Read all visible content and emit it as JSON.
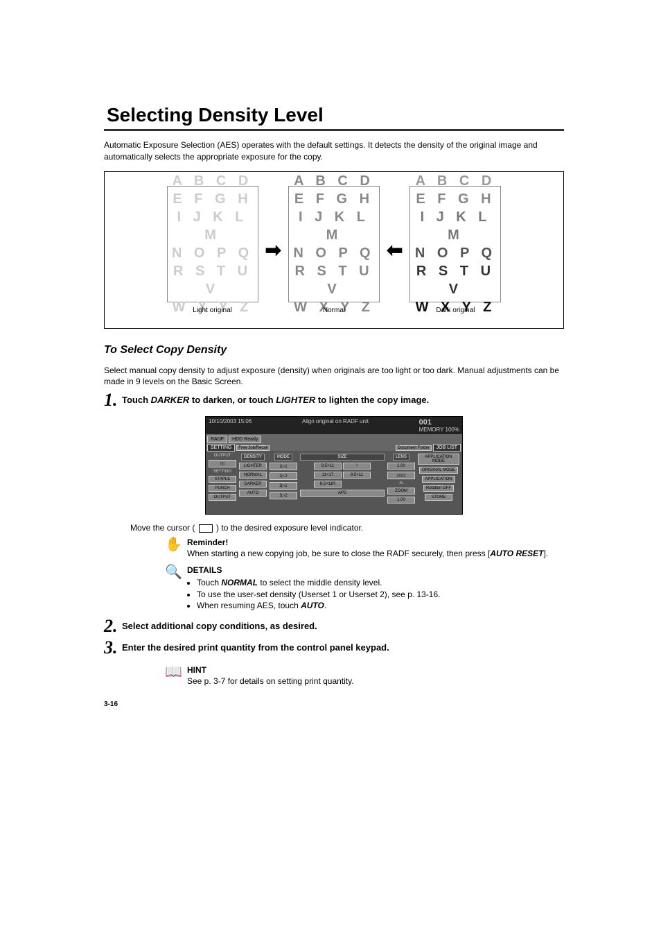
{
  "title": "Selecting Density Level",
  "intro": "Automatic Exposure Selection (AES) operates with the default settings. It detects the density of the original image and automatically selects the appropriate exposure for the copy.",
  "diagram": {
    "letters": [
      "A B C D",
      "E F G H",
      "I J K L M",
      "N O P Q",
      "R S T U V",
      "W X Y Z"
    ],
    "captions": {
      "light": "Light original",
      "normal": "Normal",
      "dark": "Dark original"
    }
  },
  "subheading": "To Select Copy Density",
  "subbody": "Select manual copy density to adjust exposure (density) when originals are too light or too dark. Manual adjustments can be made in 9 levels on the Basic Screen.",
  "steps": {
    "s1": {
      "num": "1.",
      "pre": "Touch ",
      "darker": "DARKER",
      "mid": " to darken, or touch ",
      "lighter": "LIGHTER",
      "post": " to lighten the copy image."
    },
    "s2": {
      "num": "2.",
      "text": "Select additional copy conditions, as desired."
    },
    "s3": {
      "num": "3.",
      "text": "Enter the desired print quantity from the control panel keypad."
    }
  },
  "screenshot": {
    "topbar": {
      "datetime": "10/10/2003 15:06",
      "msg": "Align original on RADF unit",
      "count": "001",
      "memory": "MEMORY 100%"
    },
    "tabs": {
      "radf": "RADF",
      "hdd": "HDD Ready"
    },
    "row2": {
      "setting": "SETTING",
      "recall": "Free Job/Recall",
      "docfolder": "Document Folder",
      "joblist": "JOB LIST"
    },
    "leftOutput": {
      "label": "OUTPUT",
      "sample": "▯▯"
    },
    "leftSetting": {
      "label": "SETTING",
      "staple": "STAPLE",
      "punch": "PUNCH",
      "output": "OUTPUT"
    },
    "density": {
      "header": "DENSITY",
      "lighter": "LIGHTER",
      "normal": "NORMAL",
      "darker": "DARKER",
      "auto": "AUTO"
    },
    "mode": {
      "header": "MODE",
      "m1": "1▷1",
      "m2": "1▷2",
      "m3": "2▷1",
      "m4": "2▷2"
    },
    "size": {
      "header": "SIZE",
      "s1": "8.5×11",
      "s2": "11×17",
      "s3": "8.5×11R",
      "s4": "8.5×11",
      "s5": "!",
      "aps": "APS"
    },
    "lens": {
      "header": "LENS",
      "v1": "1.00",
      "pages": "▯▯▯▯",
      "hyphen": "-A-",
      "zoom": "ZOOM",
      "v2": "1.00"
    },
    "right": {
      "appmode": "APPLICATION MODE",
      "origmode": "ORIGINAL MODE",
      "application": "APPLICATION",
      "rotoff": "Rotation OFF",
      "store": "STORE"
    }
  },
  "cursor": {
    "pre": "Move the cursor ( ",
    "post": " ) to the desired exposure level indicator."
  },
  "reminder": {
    "title": "Reminder!",
    "text_pre": "When starting a new copying job, be sure to close the RADF securely, then press [",
    "autoreset": "AUTO RESET",
    "text_post": "]."
  },
  "details": {
    "title": "DETAILS",
    "b1_pre": "Touch ",
    "b1_bold": "NORMAL",
    "b1_post": " to select the middle density level.",
    "b2": "To use the user-set density (Userset 1 or Userset 2), see p. 13-16.",
    "b3_pre": "When resuming AES, touch ",
    "b3_bold": "AUTO",
    "b3_post": "."
  },
  "hint": {
    "title": "HINT",
    "text": "See p. 3-7 for details on setting print quantity."
  },
  "pageNum": "3-16"
}
